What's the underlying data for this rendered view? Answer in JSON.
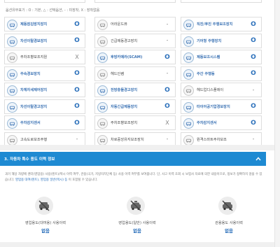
{
  "legend": "옵션유무표기 : O : 기본, △ : 선택옵션, - : 미장착, X : 장착없음",
  "options": [
    [
      {
        "label": "제동잠김방지장치",
        "value": "O",
        "icon": "abs-icon",
        "style": "blue"
      },
      {
        "label": "어라운드뷰",
        "value": "-",
        "icon": "around-view-icon",
        "style": "dark"
      },
      {
        "label": "직진/후진 주행보조장치",
        "value": "O",
        "icon": "steering-assist-icon",
        "style": "blue"
      }
    ],
    [
      {
        "label": "차선이탈경보장치",
        "value": "O",
        "icon": "lane-departure-icon",
        "style": "blue"
      },
      {
        "label": "긴급제동경고장치",
        "value": "-",
        "icon": "emergency-brake-icon",
        "style": "dark"
      },
      {
        "label": "기어형 주행장치",
        "value": "O",
        "icon": "gear-drive-icon",
        "style": "blue"
      }
    ],
    [
      {
        "label": "주차조향보조지원",
        "value": "X",
        "icon": "parking-steer-icon",
        "style": "dark"
      },
      {
        "label": "후방카메라(SCAM)",
        "value": "O",
        "icon": "rear-camera-icon",
        "style": "blue"
      },
      {
        "label": "제동보조시스템",
        "value": "O",
        "icon": "brake-assist-icon",
        "style": "blue"
      }
    ],
    [
      {
        "label": "주속경보장치",
        "value": "O",
        "icon": "speed-warning-icon",
        "style": "blue"
      },
      {
        "label": "헤드인램",
        "value": "-",
        "icon": "head-lamp-icon",
        "style": "dark"
      },
      {
        "label": "주간 주행등",
        "value": "O",
        "icon": "daytime-light-icon",
        "style": "blue"
      }
    ],
    [
      {
        "label": "차체자세제어장치",
        "value": "O",
        "icon": "stability-control-icon",
        "style": "blue"
      },
      {
        "label": "전방충돌경고장치",
        "value": "O",
        "icon": "forward-collision-icon",
        "style": "blue"
      },
      {
        "label": "헤드업디스플레이",
        "value": "-",
        "icon": "hud-icon",
        "style": "dark"
      }
    ],
    [
      {
        "label": "차선이탈경고장치",
        "value": "O",
        "icon": "lane-warning-icon",
        "style": "blue"
      },
      {
        "label": "자동긴급제동장치",
        "value": "O",
        "icon": "auto-brake-icon",
        "style": "blue"
      },
      {
        "label": "타이어공기압경보장치",
        "value": "O",
        "icon": "tire-pressure-icon",
        "style": "blue"
      }
    ],
    [
      {
        "label": "주차감지센서",
        "value": "O",
        "icon": "parking-sensor-icon",
        "style": "blue"
      },
      {
        "label": "주차조향보조장치",
        "value": "X",
        "icon": "parking-assist-icon",
        "style": "dark"
      },
      {
        "label": "주차감지센서",
        "value": "O",
        "icon": "parking-sensor-2-icon",
        "style": "blue"
      }
    ],
    [
      {
        "label": "고속도로보조주행",
        "value": "-",
        "icon": "highway-assist-icon",
        "style": "dark"
      },
      {
        "label": "차로중앙유지보조장치",
        "value": "-",
        "icon": "lane-center-icon",
        "style": "dark"
      },
      {
        "label": "원격스마트주차보조",
        "value": "-",
        "icon": "remote-parking-icon",
        "style": "dark"
      }
    ]
  ],
  "section": {
    "title": "3. 자동차 특수 용도 이력 정보"
  },
  "notice": {
    "text_a": "과거 해당 차량에 렌터(영업용) 사용(렌트)/택시 이력 여부, 관용(국가, 지방자치단체 등) 사용 이력 여부를 보여줍니다. 단, 사고 이력 조회 시 보험사 자료에 의한 내용이므로, 정보가 정확하지 않을 수 있습니다.",
    "text_b": "영업용 대여(렌트), 영업용 일반(택시) 등",
    "text_c": "이 포함될 수 있습니다."
  },
  "usage": [
    {
      "label": "영업용도(대여용) 사용이력",
      "value": "없음",
      "icon": "rental-car-icon"
    },
    {
      "label": "영업용도(일반) 사용이력",
      "value": "없음",
      "icon": "taxi-icon"
    },
    {
      "label": "관용용도 사용이력",
      "value": "없음",
      "icon": "government-car-icon"
    }
  ],
  "colors": {
    "accent": "#1e8ad2",
    "label_blue": "#3c73b4",
    "value_blue": "#2a6fba"
  }
}
